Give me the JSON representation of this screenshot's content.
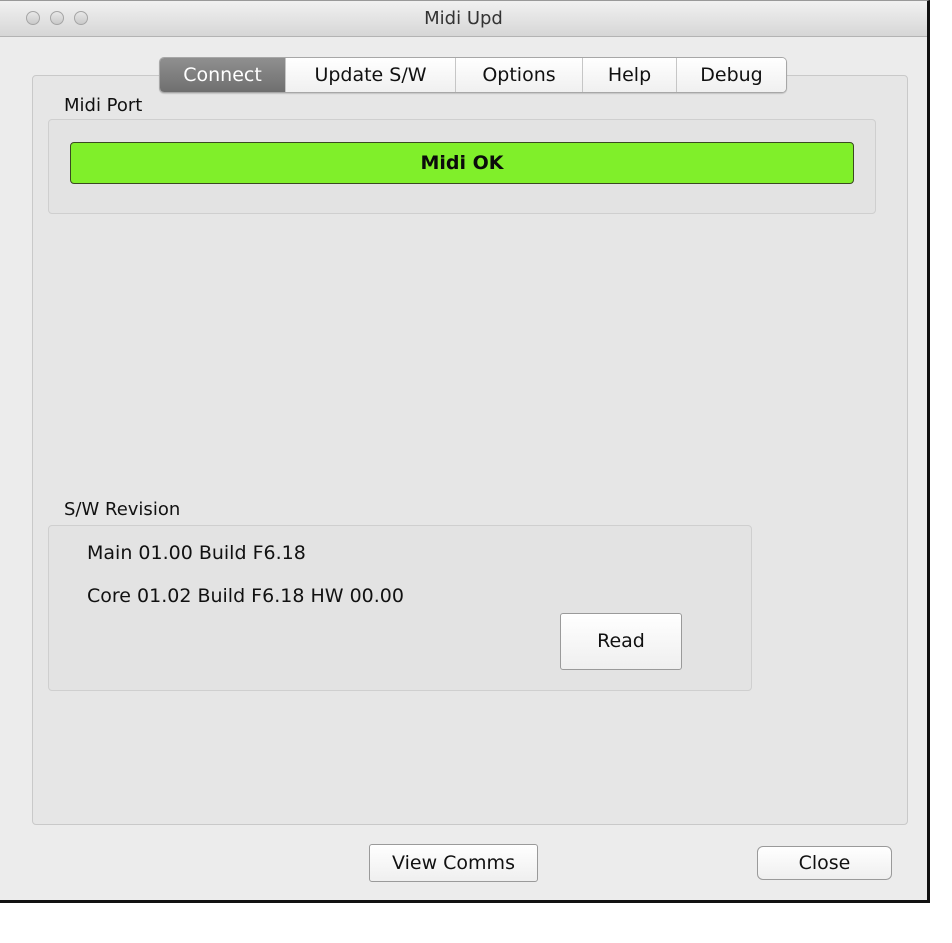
{
  "window": {
    "title": "Midi  Upd"
  },
  "tabs": [
    {
      "label": "Connect",
      "active": true
    },
    {
      "label": "Update S/W",
      "active": false
    },
    {
      "label": "Options",
      "active": false
    },
    {
      "label": "Help",
      "active": false
    },
    {
      "label": "Debug",
      "active": false
    }
  ],
  "midi_port": {
    "label": "Midi Port",
    "status": "Midi OK",
    "status_color": "#80ef2a"
  },
  "sw_revision": {
    "label": "S/W Revision",
    "main": "Main 01.00 Build F6.18",
    "core": "Core 01.02 Build F6.18 HW 00.00",
    "read_label": "Read"
  },
  "footer": {
    "view_comms_label": "View Comms",
    "close_label": "Close"
  }
}
